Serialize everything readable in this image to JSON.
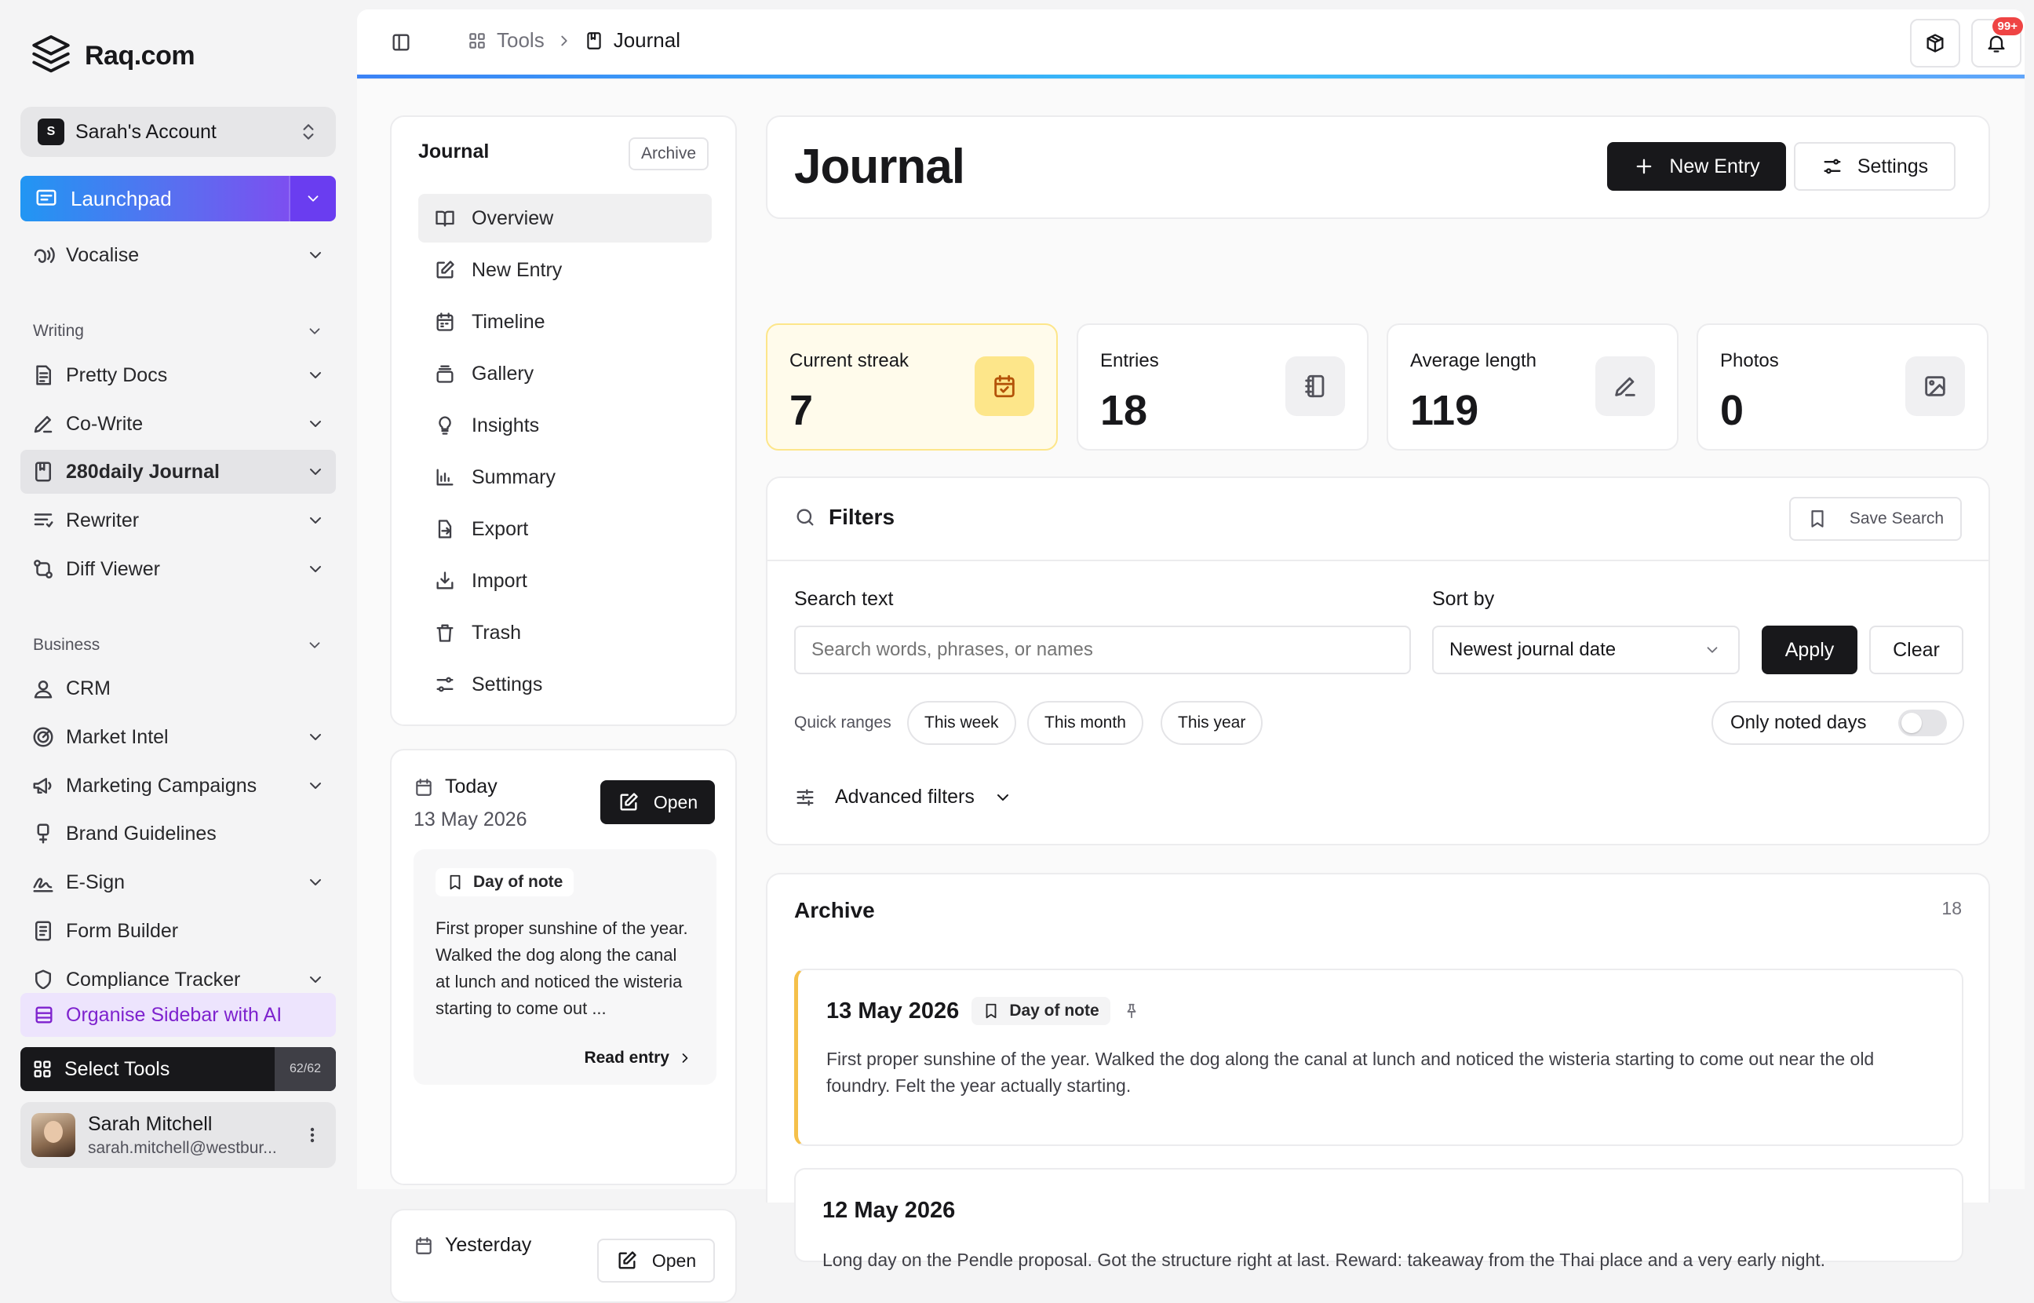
{
  "app": {
    "name": "Raq.com"
  },
  "sidebar": {
    "account": {
      "initial": "S",
      "name": "Sarah's Account"
    },
    "launchpad": "Launchpad",
    "vocalise": "Vocalise",
    "sections": {
      "writing": "Writing",
      "business": "Business"
    },
    "writing_items": [
      {
        "label": "Pretty Docs",
        "icon": "document-icon"
      },
      {
        "label": "Co-Write",
        "icon": "pen-icon"
      },
      {
        "label": "280daily Journal",
        "icon": "journal-icon"
      },
      {
        "label": "Rewriter",
        "icon": "rewrite-icon"
      },
      {
        "label": "Diff Viewer",
        "icon": "diff-icon"
      }
    ],
    "business_items": [
      {
        "label": "CRM",
        "icon": "contact-icon"
      },
      {
        "label": "Market Intel",
        "icon": "radar-icon"
      },
      {
        "label": "Marketing Campaigns",
        "icon": "megaphone-icon"
      },
      {
        "label": "Brand Guidelines",
        "icon": "brand-icon"
      },
      {
        "label": "E-Sign",
        "icon": "signature-icon"
      },
      {
        "label": "Form Builder",
        "icon": "form-icon"
      },
      {
        "label": "Compliance Tracker",
        "icon": "shield-icon"
      }
    ],
    "organise": "Organise Sidebar with AI",
    "select_tools": "Select Tools",
    "tools_count": "62/62",
    "user": {
      "name": "Sarah Mitchell",
      "email": "sarah.mitchell@westbur..."
    }
  },
  "topbar": {
    "breadcrumb": {
      "tools": "Tools",
      "current": "Journal"
    },
    "notifications_badge": "99+"
  },
  "journal_menu": {
    "title": "Journal",
    "archive_button": "Archive",
    "items": [
      "Overview",
      "New Entry",
      "Timeline",
      "Gallery",
      "Insights",
      "Summary",
      "Export",
      "Import",
      "Trash",
      "Settings"
    ]
  },
  "today_card": {
    "label": "Today",
    "date": "13 May 2026",
    "open_button": "Open",
    "tag": "Day of note",
    "excerpt": "First proper sunshine of the year. Walked the dog along the canal at lunch and noticed the wisteria starting to come out ...",
    "read_entry": "Read entry"
  },
  "yesterday_card": {
    "label": "Yesterday",
    "open_button": "Open"
  },
  "header": {
    "title": "Journal",
    "new_entry": "New Entry",
    "settings": "Settings"
  },
  "stats": [
    {
      "label": "Current streak",
      "value": "7",
      "icon": "calendar-icon"
    },
    {
      "label": "Entries",
      "value": "18",
      "icon": "notebook-icon"
    },
    {
      "label": "Average length",
      "value": "119",
      "icon": "pencil-icon"
    },
    {
      "label": "Photos",
      "value": "0",
      "icon": "image-icon"
    }
  ],
  "filters": {
    "title": "Filters",
    "save_search": "Save Search",
    "search_label": "Search text",
    "search_placeholder": "Search words, phrases, or names",
    "sort_label": "Sort by",
    "sort_value": "Newest journal date",
    "apply": "Apply",
    "clear": "Clear",
    "quick_ranges_label": "Quick ranges",
    "quick_ranges": [
      "This week",
      "This month",
      "This year"
    ],
    "only_noted": "Only noted days",
    "only_noted_on": false,
    "advanced": "Advanced filters"
  },
  "archive": {
    "title": "Archive",
    "count": "18",
    "entries": [
      {
        "date": "13 May 2026",
        "tag": "Day of note",
        "text": "First proper sunshine of the year. Walked the dog along the canal at lunch and noticed the wisteria starting to come out near the old foundry. Felt the year actually starting."
      },
      {
        "date": "12 May 2026",
        "text": "Long day on the Pendle proposal. Got the structure right at last. Reward: takeaway from the Thai place and a very early night."
      }
    ]
  },
  "colors": {
    "accent": "#18181b",
    "launchpad_start": "#2196f3",
    "launchpad_end": "#7c4ff0",
    "streak_bg": "#fffbeb",
    "note_border": "#f5c04a"
  }
}
